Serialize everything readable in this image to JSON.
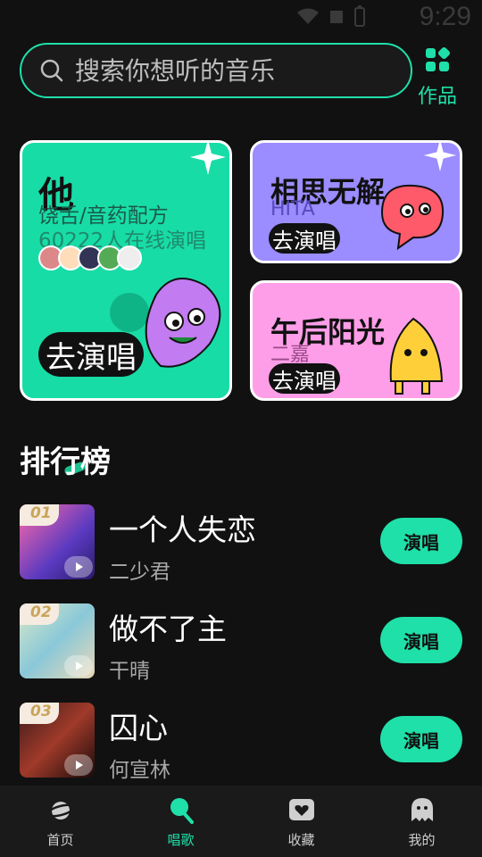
{
  "status": {
    "time": "9:29"
  },
  "search": {
    "placeholder": "搜索你想听的音乐"
  },
  "works": {
    "label": "作品"
  },
  "cards": {
    "big": {
      "title": "他",
      "subtitle": "饶舌/音药配方",
      "online": "60222人在线演唱",
      "cta": "去演唱"
    },
    "small1": {
      "title": "相思无解",
      "artist": "HITA",
      "cta": "去演唱"
    },
    "small2": {
      "title": "午后阳光",
      "artist": "二嘉",
      "cta": "去演唱"
    }
  },
  "ranking": {
    "title": "排行榜",
    "items": [
      {
        "rank": "01",
        "title": "一个人失恋",
        "artist": "二少君",
        "action": "演唱"
      },
      {
        "rank": "02",
        "title": "做不了主",
        "artist": "干晴",
        "action": "演唱"
      },
      {
        "rank": "03",
        "title": "囚心",
        "artist": "何宣林",
        "action": "演唱"
      }
    ]
  },
  "nav": {
    "items": [
      {
        "label": "首页",
        "icon": "planet-icon"
      },
      {
        "label": "唱歌",
        "icon": "microphone-icon"
      },
      {
        "label": "收藏",
        "icon": "heart-box-icon"
      },
      {
        "label": "我的",
        "icon": "ghost-icon"
      }
    ],
    "active": "唱歌"
  },
  "colors": {
    "accent": "#1fe0a8",
    "background": "#111111",
    "card_green": "#18dca6",
    "card_purple": "#9b8cff",
    "card_pink": "#ff9ee8"
  }
}
